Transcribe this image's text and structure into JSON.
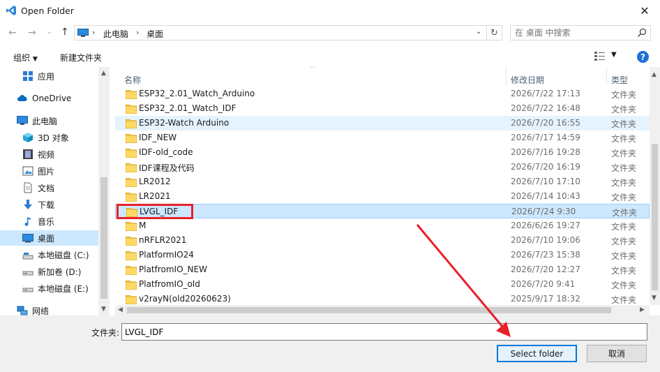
{
  "window": {
    "title": "Open Folder"
  },
  "address": {
    "crumbs": [
      "此电脑",
      "桌面"
    ]
  },
  "search": {
    "placeholder": "在 桌面 中搜索"
  },
  "toolbar": {
    "organize": "组织",
    "new_folder": "新建文件夹"
  },
  "sidebar": {
    "items": [
      {
        "label": "应用",
        "icon": "apps-icon"
      },
      {
        "label": "OneDrive",
        "icon": "cloud-icon"
      },
      {
        "label": "此电脑",
        "icon": "pc-icon"
      },
      {
        "label": "3D 对象",
        "icon": "cube-icon"
      },
      {
        "label": "视频",
        "icon": "video-icon"
      },
      {
        "label": "图片",
        "icon": "picture-icon"
      },
      {
        "label": "文档",
        "icon": "document-icon"
      },
      {
        "label": "下载",
        "icon": "download-icon"
      },
      {
        "label": "音乐",
        "icon": "music-icon"
      },
      {
        "label": "桌面",
        "icon": "desktop-icon",
        "selected": true
      },
      {
        "label": "本地磁盘 (C:)",
        "icon": "drive-icon"
      },
      {
        "label": "新加卷 (D:)",
        "icon": "drive-icon"
      },
      {
        "label": "本地磁盘 (E:)",
        "icon": "drive-icon"
      },
      {
        "label": "网络",
        "icon": "network-icon"
      }
    ]
  },
  "columns": {
    "name": "名称",
    "date": "修改日期",
    "type": "类型"
  },
  "files": [
    {
      "name": "ESP32_2.01_Watch_Arduino",
      "date": "2026/7/22 17:13",
      "type": "文件夹"
    },
    {
      "name": "ESP32_2.01_Watch_IDF",
      "date": "2026/7/22 16:48",
      "type": "文件夹"
    },
    {
      "name": "ESP32-Watch Arduino",
      "date": "2026/7/20 16:55",
      "type": "文件夹",
      "state": "hover"
    },
    {
      "name": "IDF_NEW",
      "date": "2026/7/17 14:59",
      "type": "文件夹"
    },
    {
      "name": "IDF-old_code",
      "date": "2026/7/16 19:28",
      "type": "文件夹"
    },
    {
      "name": "IDF课程及代码",
      "date": "2026/7/20 16:19",
      "type": "文件夹"
    },
    {
      "name": "LR2012",
      "date": "2026/7/10 17:10",
      "type": "文件夹"
    },
    {
      "name": "LR2021",
      "date": "2026/7/14 10:43",
      "type": "文件夹"
    },
    {
      "name": "LVGL_IDF",
      "date": "2026/7/24 9:30",
      "type": "文件夹",
      "state": "selected"
    },
    {
      "name": "M",
      "date": "2026/6/26 19:27",
      "type": "文件夹"
    },
    {
      "name": "nRFLR2021",
      "date": "2026/7/10 19:06",
      "type": "文件夹"
    },
    {
      "name": "PlatformIO24",
      "date": "2026/7/23 15:38",
      "type": "文件夹"
    },
    {
      "name": "PlatfromIO_NEW",
      "date": "2026/7/20 12:27",
      "type": "文件夹"
    },
    {
      "name": "PlatfromIO_old",
      "date": "2026/7/20 9:41",
      "type": "文件夹"
    },
    {
      "name": "v2rayN(old20260623)",
      "date": "2025/9/17 18:32",
      "type": "文件夹"
    }
  ],
  "footer": {
    "folder_label": "文件夹:",
    "folder_value": "LVGL_IDF",
    "select_button": "Select folder",
    "cancel_button": "取消"
  },
  "colors": {
    "accent": "#0078d7",
    "selection": "#cce8ff",
    "annotation_red": "#e8202a",
    "folder": "#f4c542"
  }
}
